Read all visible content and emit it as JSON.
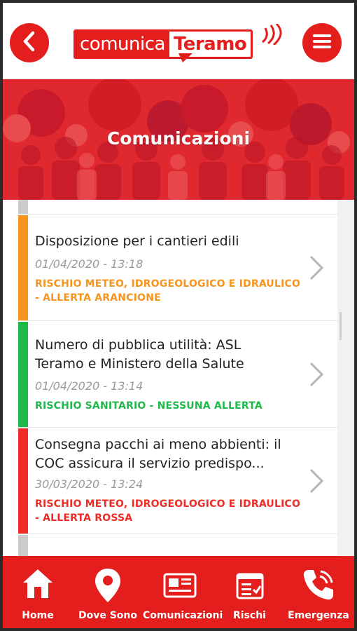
{
  "header": {
    "logo_part1": "comunica",
    "logo_part2": "Teramo",
    "back_icon": "chevron-left-icon",
    "menu_icon": "hamburger-menu-icon"
  },
  "banner": {
    "title": "Comunicazioni"
  },
  "communications": [
    {
      "title": "Disposizione per i cantieri edili",
      "date": "01/04/2020 - 13:18",
      "category": "RISCHIO METEO, IDROGEOLOGICO E IDRAULICO - ALLERTA ARANCIONE",
      "color": "#f7941d"
    },
    {
      "title": "Numero di pubblica utilità: ASL Teramo e Ministero della Salute",
      "date": "01/04/2020 - 13:14",
      "category": "RISCHIO SANITARIO - NESSUNA ALLERTA",
      "color": "#1fb84a"
    },
    {
      "title": "Consegna pacchi ai meno abbienti: il COC assicura il servizio predispo...",
      "date": "30/03/2020 - 13:24",
      "category": "RISCHIO METEO, IDROGEOLOGICO E IDRAULICO - ALLERTA ROSSA",
      "color": "#ee2b24"
    }
  ],
  "nav": [
    {
      "label": "Home",
      "icon": "home-icon"
    },
    {
      "label": "Dove Sono",
      "icon": "location-pin-icon"
    },
    {
      "label": "Comunicazioni",
      "icon": "newspaper-icon"
    },
    {
      "label": "Rischi",
      "icon": "checklist-icon"
    },
    {
      "label": "Emergenza",
      "icon": "phone-call-icon"
    }
  ],
  "colors": {
    "brand_red": "#e41d1d",
    "orange": "#f7941d",
    "green": "#1fb84a",
    "red": "#ee2b24"
  }
}
